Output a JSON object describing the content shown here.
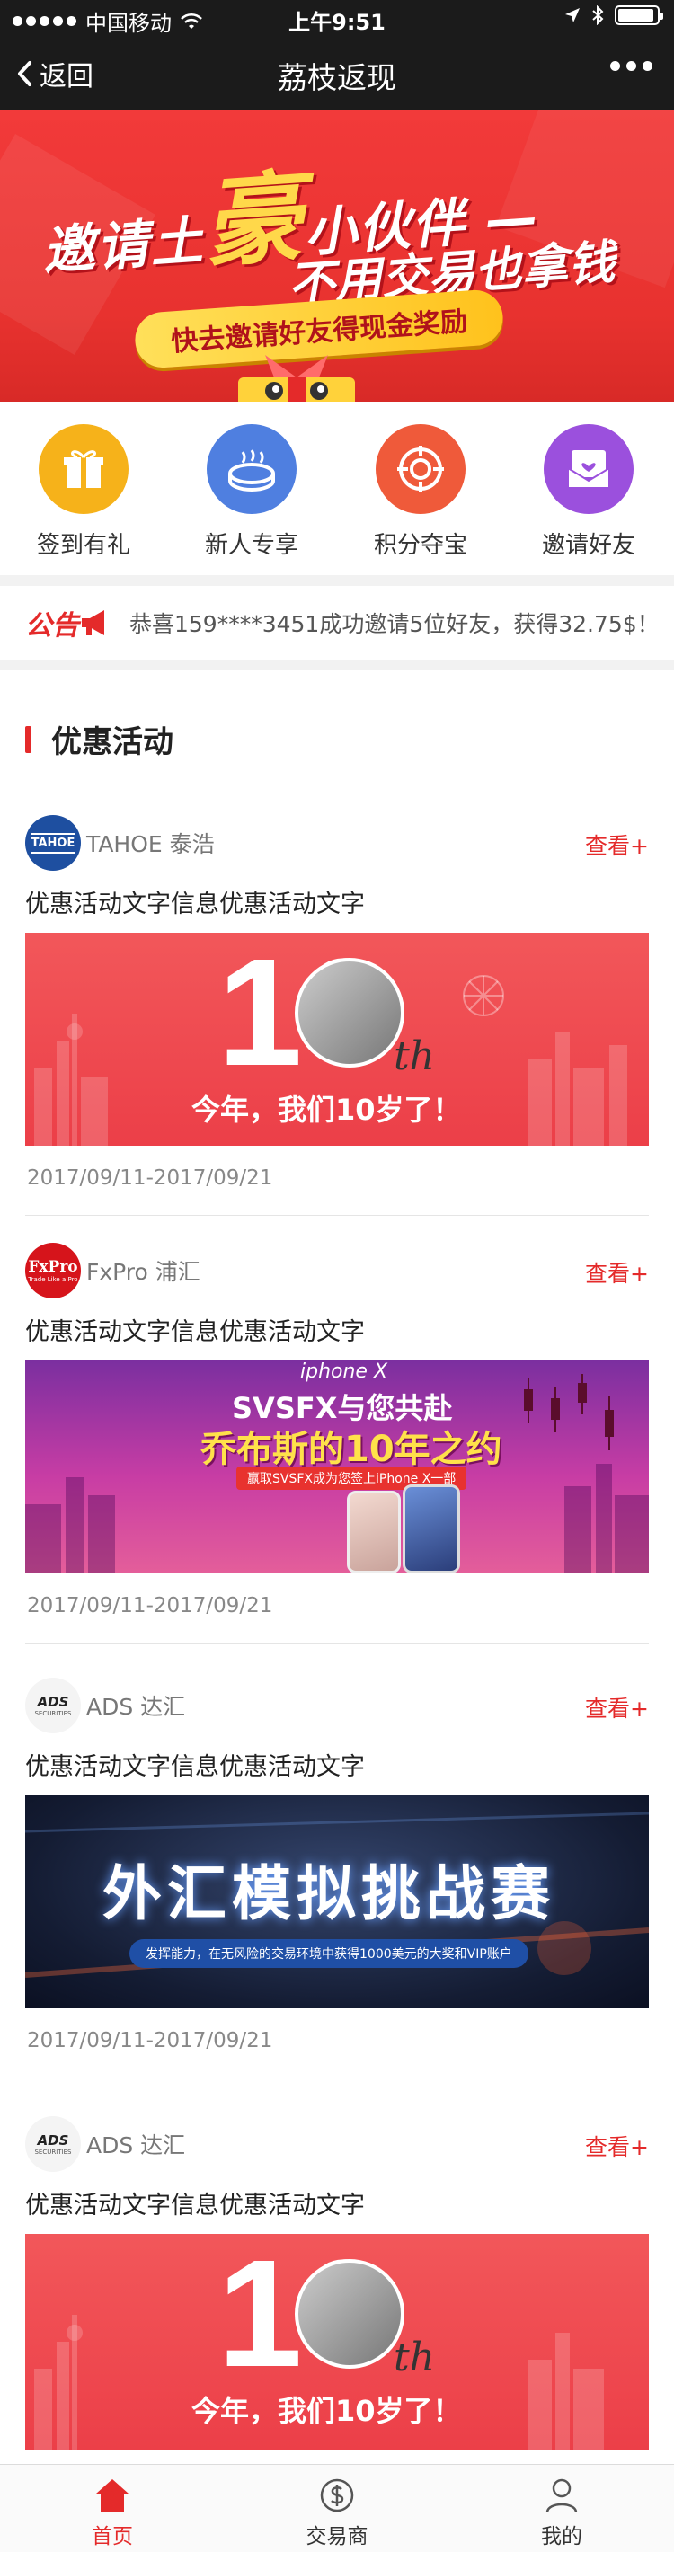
{
  "status_bar": {
    "carrier": "中国移动",
    "time": "上午9:51"
  },
  "nav": {
    "back_label": "返回",
    "title": "荔枝返现"
  },
  "banner": {
    "headline_pre": "邀请土",
    "headline_big": "豪",
    "headline_post": "小伙伴 —",
    "line2": "不用交易也拿钱",
    "pill": "快去邀请好友得现金奖励"
  },
  "quick_menu": [
    {
      "label": "签到有礼",
      "icon": "gift-icon",
      "color": "#f6b21a"
    },
    {
      "label": "新人专享",
      "icon": "new-user-icon",
      "color": "#4f7fe0"
    },
    {
      "label": "积分夺宝",
      "icon": "treasure-icon",
      "color": "#ef5a3a"
    },
    {
      "label": "邀请好友",
      "icon": "invite-mail-icon",
      "color": "#9b50dd"
    }
  ],
  "notice": {
    "tag": "公告",
    "text": "恭喜159****3451成功邀请5位好友，获得32.75$！"
  },
  "section": {
    "title": "优惠活动"
  },
  "promotions": [
    {
      "brand": "TAHOE 泰浩",
      "logo_text": "TAHOE",
      "logo_color": "#1e4fa0",
      "view_label": "查看+",
      "title": "优惠活动文字信息优惠活动文字",
      "banner_big": "10",
      "banner_sup": "th",
      "banner_text": "今年，我们10岁了！",
      "date": "2017/09/11-2017/09/21"
    },
    {
      "brand": "FxPro 浦汇",
      "logo_text": "FxPro",
      "logo_sub": "Trade Like a Pro",
      "logo_color": "#d6141b",
      "view_label": "查看+",
      "title": "优惠活动文字信息优惠活动文字",
      "banner_brand": "iphone X",
      "banner_line1": "SVSFX与您共赴",
      "banner_line2": "乔布斯的10年之约",
      "banner_tag": "赢取SVSFX成为您签上iPhone X一部",
      "date": "2017/09/11-2017/09/21"
    },
    {
      "brand": "ADS 达汇",
      "logo_text": "ADS",
      "logo_sub": "SECURITIES",
      "logo_color": "#ffffff",
      "view_label": "查看+",
      "title": "优惠活动文字信息优惠活动文字",
      "banner_title": "外汇模拟挑战赛",
      "banner_sub": "发挥能力，在无风险的交易环境中获得1000美元的大奖和VIP账户",
      "date": "2017/09/11-2017/09/21"
    },
    {
      "brand": "ADS 达汇",
      "logo_text": "ADS",
      "logo_sub": "SECURITIES",
      "logo_color": "#ffffff",
      "view_label": "查看+",
      "title": "优惠活动文字信息优惠活动文字",
      "banner_big": "10",
      "banner_sup": "th",
      "banner_text": "今年，我们10岁了！",
      "date": ""
    }
  ],
  "tabbar": [
    {
      "label": "首页",
      "icon": "home-icon",
      "active": true
    },
    {
      "label": "交易商",
      "icon": "dollar-icon",
      "active": false
    },
    {
      "label": "我的",
      "icon": "user-icon",
      "active": false
    }
  ],
  "colors": {
    "accent": "#e42a2a",
    "nav_bg": "#1b1b1b"
  }
}
